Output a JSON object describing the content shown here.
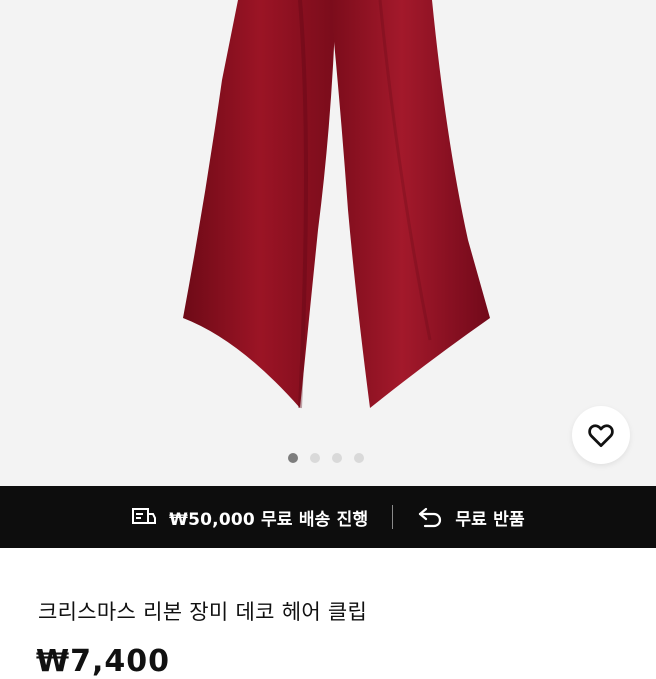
{
  "product": {
    "image_alt": "burgundy velvet ribbon",
    "title": "크리스마스 리본 장미 데코 헤어 클립",
    "price": "₩7,400"
  },
  "carousel": {
    "count": 4,
    "active_index": 0
  },
  "banner": {
    "shipping_text": "₩50,000 무료 배송 진행",
    "return_text": "무료 반품"
  },
  "icons": {
    "wishlist": "heart-outline-icon",
    "shipping": "delivery-truck-icon",
    "return": "return-arrow-icon"
  },
  "colors": {
    "ribbon": "#8e0f1f",
    "banner_bg": "#0d0d0d",
    "hero_bg": "#f3f3f3"
  }
}
